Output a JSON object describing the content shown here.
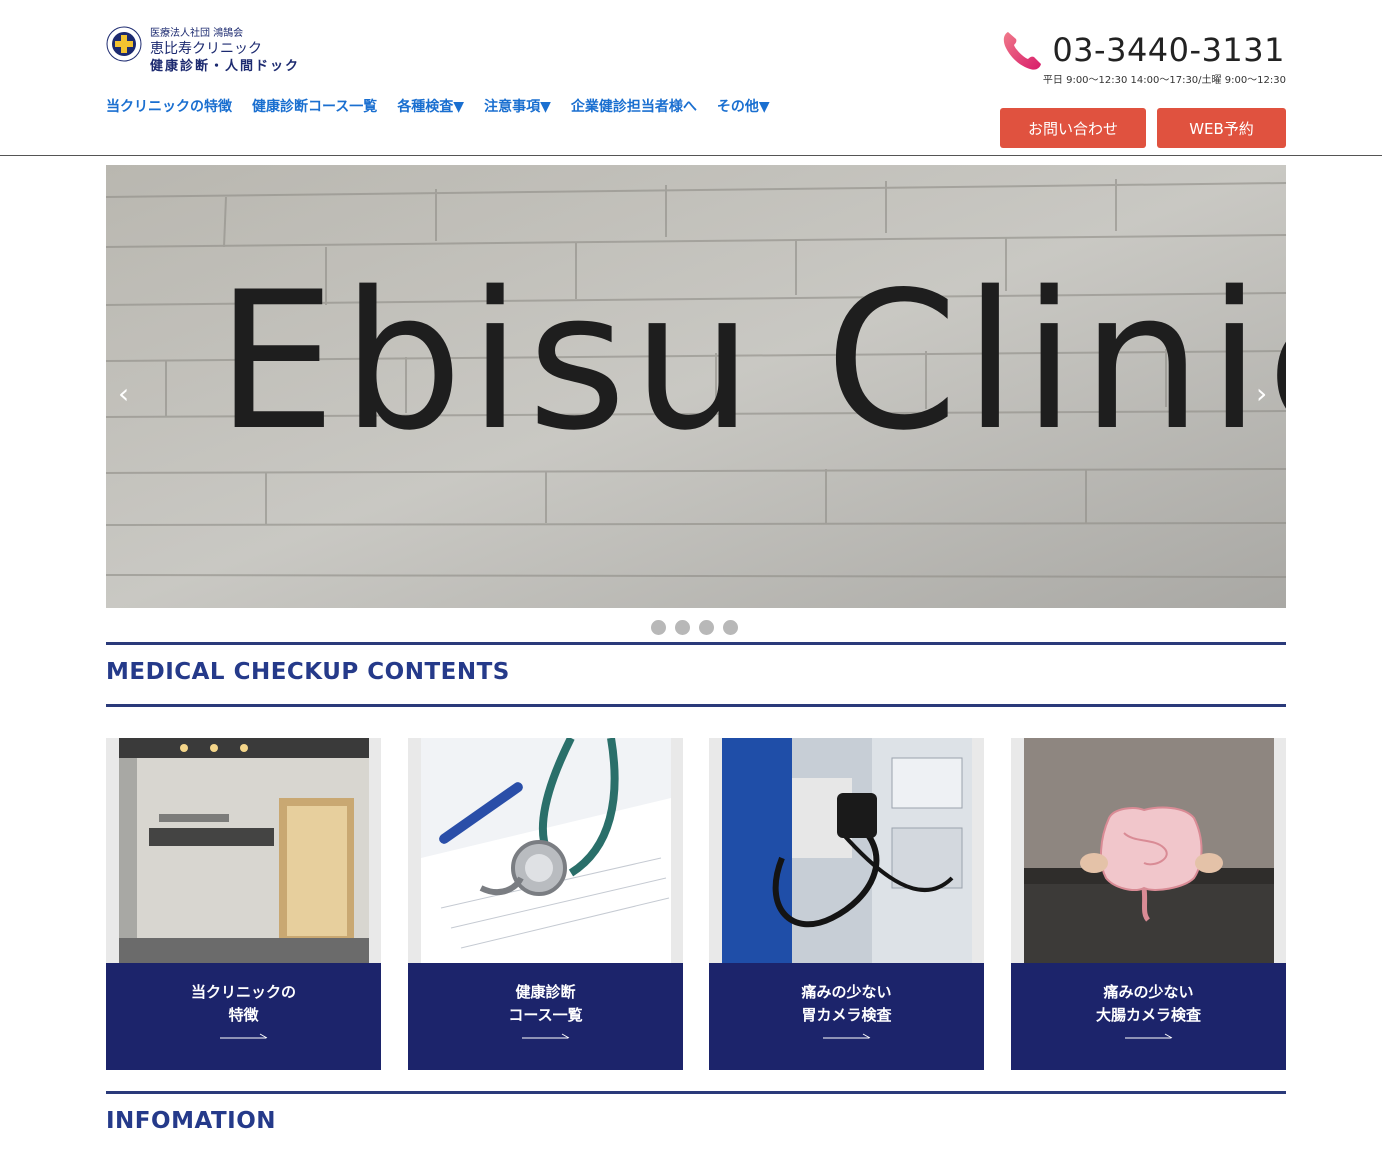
{
  "header": {
    "logo": {
      "ring_text": "HIKARI",
      "org": "医療法人社団 鴻鵠会",
      "name": "恵比寿クリニック",
      "sub": "健康診断・人間ドック"
    },
    "nav": [
      {
        "label": "当クリニックの特徴"
      },
      {
        "label": "健康診断コース一覧"
      },
      {
        "label": "各種検査▼"
      },
      {
        "label": "注意事項▼"
      },
      {
        "label": "企業健診担当者様へ"
      },
      {
        "label": "その他▼"
      }
    ],
    "phone": {
      "icon": "phone-icon",
      "number": "03-3440-3131",
      "hours": "平日 9:00～12:30 14:00～17:30/土曜 9:00～12:30"
    },
    "buttons": {
      "contact": "お問い合わせ",
      "web": "WEB予約"
    }
  },
  "hero": {
    "sign_text": "Ebisu Clinic",
    "prev": "‹",
    "next": "›",
    "dots": 4
  },
  "sections": {
    "contents_title": "MEDICAL CHECKUP CONTENTS",
    "info_title": "INFOMATION"
  },
  "cards": [
    {
      "line1": "当クリニックの",
      "line2": "特徴",
      "image": "clinic-entrance-photo"
    },
    {
      "line1": "健康診断",
      "line2": "コース一覧",
      "image": "stethoscope-photo"
    },
    {
      "line1": "痛みの少ない",
      "line2": "胃カメラ検査",
      "image": "gastroscope-photo"
    },
    {
      "line1": "痛みの少ない",
      "line2": "大腸カメラ検査",
      "image": "intestine-photo"
    }
  ],
  "colors": {
    "accent_button": "#e0523f",
    "nav_link": "#1a6fd0",
    "title": "#253a8a",
    "card_band": "#1c246b"
  }
}
